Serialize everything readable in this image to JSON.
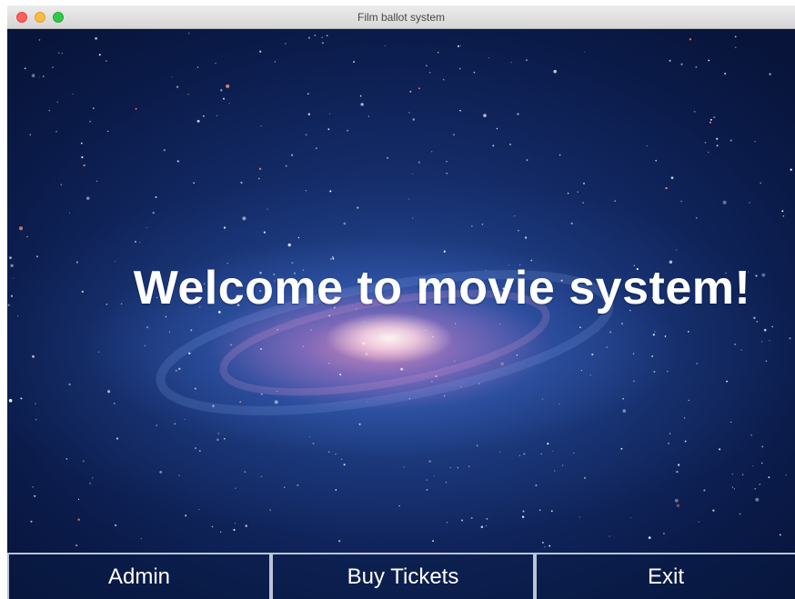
{
  "window": {
    "title": "Film ballot system"
  },
  "main": {
    "welcome_text": "Welcome to movie system!"
  },
  "buttons": {
    "admin": "Admin",
    "buy_tickets": "Buy Tickets",
    "exit": "Exit"
  },
  "colors": {
    "background_dark": "#0a1a46",
    "button_border": "#b9c4d6",
    "text": "#ffffff"
  }
}
